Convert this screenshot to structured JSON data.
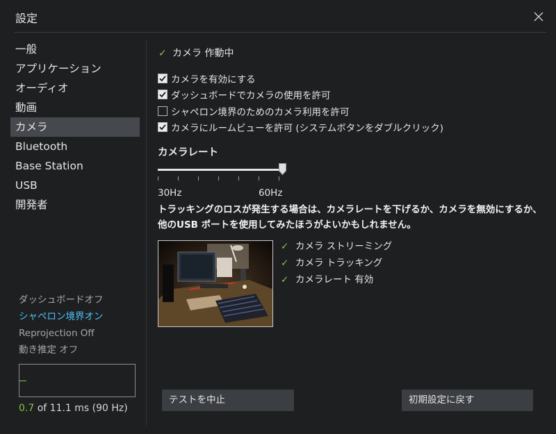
{
  "window": {
    "title": "設定",
    "close_icon": "close-icon"
  },
  "sidebar": {
    "items": [
      {
        "label": "一般"
      },
      {
        "label": "アプリケーション"
      },
      {
        "label": "オーディオ"
      },
      {
        "label": "動画"
      },
      {
        "label": "カメラ",
        "active": true
      },
      {
        "label": "Bluetooth"
      },
      {
        "label": "Base Station"
      },
      {
        "label": "USB"
      },
      {
        "label": "開発者"
      }
    ]
  },
  "status": {
    "dashboard": "ダッシュボードオフ",
    "chaperone": "シャペロン境界オン",
    "reprojection": "Reprojection Off",
    "motion": "動き推定 オフ"
  },
  "performance": {
    "value": "0.7",
    "suffix": " of 11.1 ms (90 Hz)",
    "bar_fraction": 0.063
  },
  "camera": {
    "status_label": "カメラ 作動中",
    "options": [
      {
        "label": "カメラを有効にする",
        "checked": true
      },
      {
        "label": "ダッシュボードでカメラの使用を許可",
        "checked": true
      },
      {
        "label": "シャペロン境界のためのカメラ利用を許可",
        "checked": false
      },
      {
        "label": "カメラにルームビューを許可 (システムボタンをダブルクリック)",
        "checked": true
      }
    ],
    "rate_title": "カメラレート",
    "rate_min": "30Hz",
    "rate_max": "60Hz",
    "rate_value_fraction": 1.0,
    "warning": "トラッキングのロスが発生する場合は、カメラレートを下げるか、カメラを無効にするか、他のUSB ポートを使用してみたほうがよいかもしれません。",
    "checks": [
      {
        "label": "カメラ ストリーミング"
      },
      {
        "label": "カメラ トラッキング"
      },
      {
        "label": "カメラレート 有効"
      }
    ]
  },
  "buttons": {
    "stop_test": "テストを中止",
    "reset": "初期設定に戻す"
  },
  "colors": {
    "accent_green": "#8bc34a",
    "accent_blue": "#4fc3f7",
    "background": "#1d1f21",
    "active_item": "#45484c"
  }
}
